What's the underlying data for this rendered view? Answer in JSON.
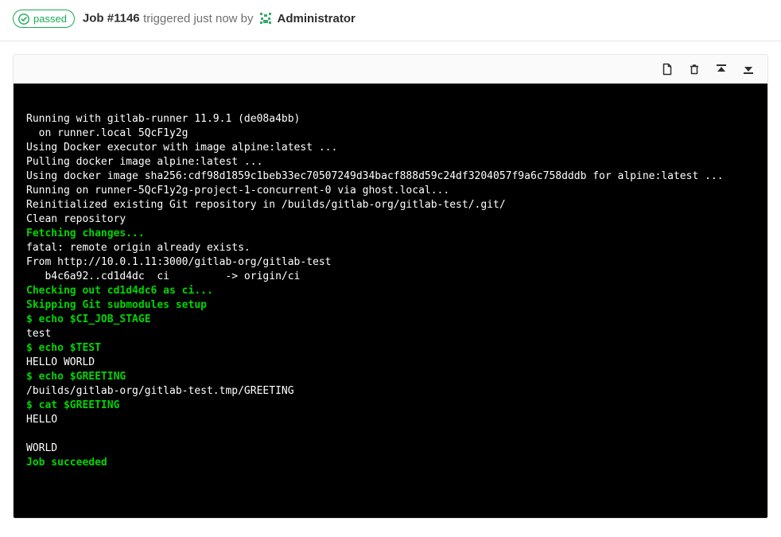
{
  "header": {
    "status_label": "passed",
    "job_label": "Job #1146",
    "triggered_text": "triggered just now by",
    "user": "Administrator"
  },
  "toolbar": {
    "raw_title": "Show complete raw",
    "erase_title": "Erase job log",
    "top_title": "Scroll to top",
    "bottom_title": "Scroll to bottom"
  },
  "log": {
    "lines": [
      {
        "t": "Running with gitlab-runner 11.9.1 (de08a4bb)",
        "c": "w"
      },
      {
        "t": "  on runner.local 5QcF1y2g",
        "c": "w"
      },
      {
        "t": "Using Docker executor with image alpine:latest ...",
        "c": "w"
      },
      {
        "t": "Pulling docker image alpine:latest ...",
        "c": "w"
      },
      {
        "t": "Using docker image sha256:cdf98d1859c1beb33ec70507249d34bacf888d59c24df3204057f9a6c758dddb for alpine:latest ...",
        "c": "w"
      },
      {
        "t": "Running on runner-5QcF1y2g-project-1-concurrent-0 via ghost.local...",
        "c": "w"
      },
      {
        "t": "Reinitialized existing Git repository in /builds/gitlab-org/gitlab-test/.git/",
        "c": "w"
      },
      {
        "t": "Clean repository",
        "c": "w"
      },
      {
        "t": "Fetching changes...",
        "c": "g"
      },
      {
        "t": "fatal: remote origin already exists.",
        "c": "w"
      },
      {
        "t": "From http://10.0.1.11:3000/gitlab-org/gitlab-test",
        "c": "w"
      },
      {
        "t": "   b4c6a92..cd1d4dc  ci         -> origin/ci",
        "c": "w"
      },
      {
        "t": "Checking out cd1d4dc6 as ci...",
        "c": "g"
      },
      {
        "t": "Skipping Git submodules setup",
        "c": "g"
      },
      {
        "t": "$ echo $CI_JOB_STAGE",
        "c": "g"
      },
      {
        "t": "test",
        "c": "w"
      },
      {
        "t": "$ echo $TEST",
        "c": "g"
      },
      {
        "t": "HELLO WORLD",
        "c": "w"
      },
      {
        "t": "$ echo $GREETING",
        "c": "g"
      },
      {
        "t": "/builds/gitlab-org/gitlab-test.tmp/GREETING",
        "c": "w"
      },
      {
        "t": "$ cat $GREETING",
        "c": "g"
      },
      {
        "t": "HELLO",
        "c": "w"
      },
      {
        "t": "",
        "c": "w"
      },
      {
        "t": "WORLD",
        "c": "w"
      },
      {
        "t": "Job succeeded",
        "c": "g"
      }
    ]
  }
}
